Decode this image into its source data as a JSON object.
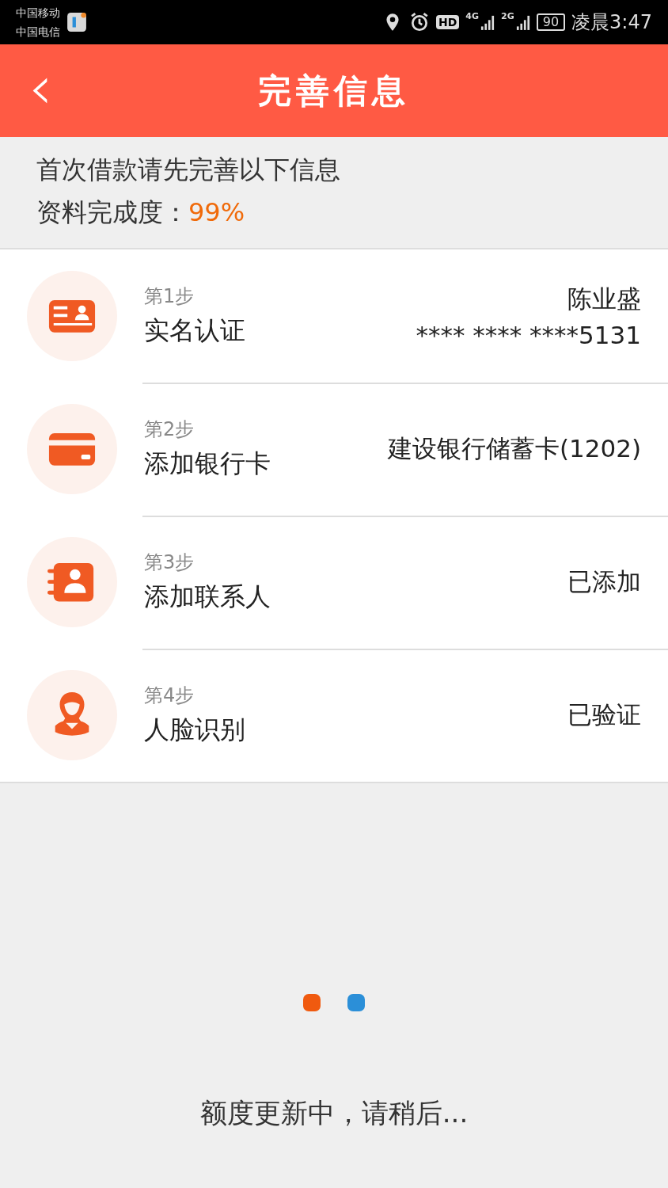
{
  "status_bar": {
    "carriers": [
      "中国移动",
      "中国电信"
    ],
    "hd": "HD",
    "network_1": "4G",
    "network_2": "2G",
    "battery": "90",
    "time": "凌晨3:47"
  },
  "header": {
    "back": "‹",
    "title": "完善信息"
  },
  "intro": {
    "line": "首次借款请先完善以下信息",
    "progress_label": "资料完成度：",
    "progress_value": "99%"
  },
  "steps": [
    {
      "kind": "id-card",
      "step": "第1步",
      "title": "实名认证",
      "values": [
        "陈业盛",
        "**** **** ****5131"
      ]
    },
    {
      "kind": "bank-card",
      "step": "第2步",
      "title": "添加银行卡",
      "values": [
        "建设银行储蓄卡(1202)"
      ]
    },
    {
      "kind": "contacts",
      "step": "第3步",
      "title": "添加联系人",
      "values": [
        "已添加"
      ]
    },
    {
      "kind": "face",
      "step": "第4步",
      "title": "人脸识别",
      "values": [
        "已验证"
      ]
    }
  ],
  "loading": {
    "dots": [
      {
        "color": "#f05a0f"
      },
      {
        "color": "#2b8fd8"
      }
    ],
    "message": "额度更新中，请稍后..."
  }
}
